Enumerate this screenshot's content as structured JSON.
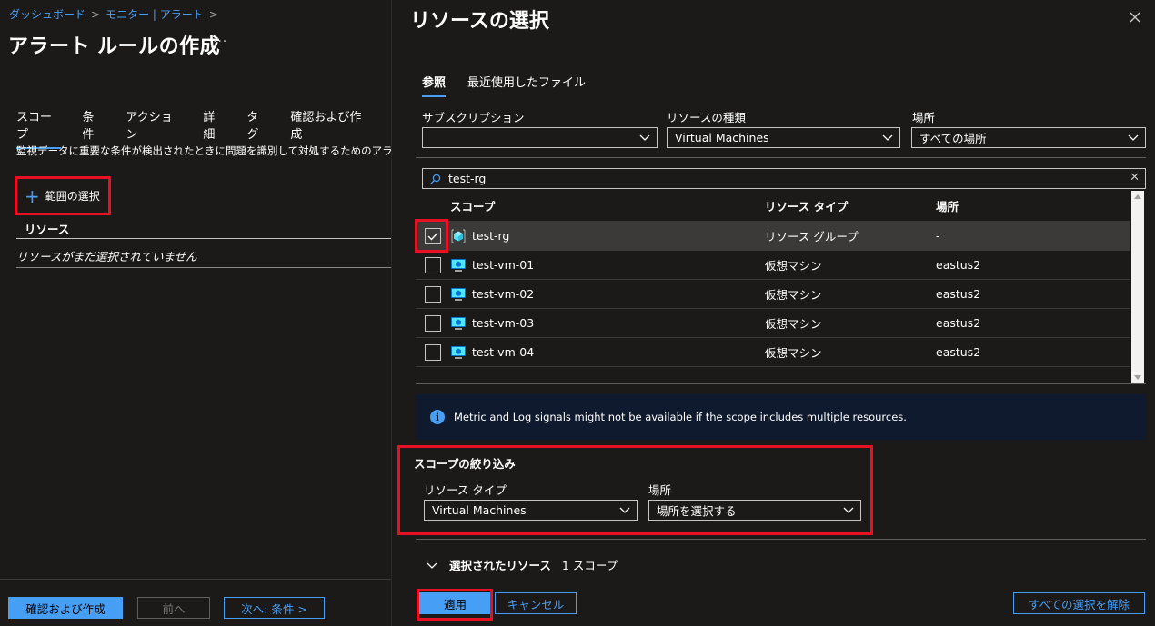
{
  "left": {
    "breadcrumb": [
      "ダッシュボード",
      "モニター | アラート"
    ],
    "breadcrumb_sep": ">",
    "title": "アラート ルールの作成",
    "more": "···",
    "tabs": [
      "スコープ",
      "条件",
      "アクション",
      "詳細",
      "タグ",
      "確認および作成"
    ],
    "description": "監視データに重要な条件が検出されたときに問題を識別して対処するためのアラー|",
    "select_scope": "範囲の選択",
    "resource_header": "リソース",
    "resource_empty": "リソースがまだ選択されていません",
    "footer": {
      "review_create": "確認および作成",
      "previous": "前へ",
      "next": "次へ: 条件 >"
    }
  },
  "panel": {
    "title": "リソースの選択",
    "tabs": [
      "参照",
      "最近使用したファイル"
    ],
    "filters": {
      "subscription_label": "サブスクリプション",
      "subscription_value": "",
      "resource_type_label": "リソースの種類",
      "resource_type_value": "Virtual Machines",
      "location_label": "場所",
      "location_value": "すべての場所"
    },
    "search_value": "test-rg",
    "table": {
      "headers": [
        "スコープ",
        "リソース タイプ",
        "場所"
      ],
      "rows": [
        {
          "name": "test-rg",
          "type": "リソース グループ",
          "location": "-",
          "checked": true,
          "icon": "resource-group-icon"
        },
        {
          "name": "test-vm-01",
          "type": "仮想マシン",
          "location": "eastus2",
          "checked": false,
          "icon": "virtual-machine-icon"
        },
        {
          "name": "test-vm-02",
          "type": "仮想マシン",
          "location": "eastus2",
          "checked": false,
          "icon": "virtual-machine-icon"
        },
        {
          "name": "test-vm-03",
          "type": "仮想マシン",
          "location": "eastus2",
          "checked": false,
          "icon": "virtual-machine-icon"
        },
        {
          "name": "test-vm-04",
          "type": "仮想マシン",
          "location": "eastus2",
          "checked": false,
          "icon": "virtual-machine-icon"
        }
      ]
    },
    "info_message": "Metric and Log signals might not be available if the scope includes multiple resources.",
    "scope_filter": {
      "title": "スコープの絞り込み",
      "resource_type_label": "リソース タイプ",
      "resource_type_value": "Virtual Machines",
      "location_label": "場所",
      "location_value": "場所を選択する"
    },
    "selected_resources": {
      "label": "選択されたリソース",
      "count": "1 スコープ"
    },
    "footer": {
      "apply": "適用",
      "cancel": "キャンセル",
      "clear_all": "すべての選択を解除"
    }
  },
  "colors": {
    "accent": "#479ef5",
    "highlight": "#e81123",
    "background": "#1b1a19",
    "info_bg": "#101a2e"
  }
}
